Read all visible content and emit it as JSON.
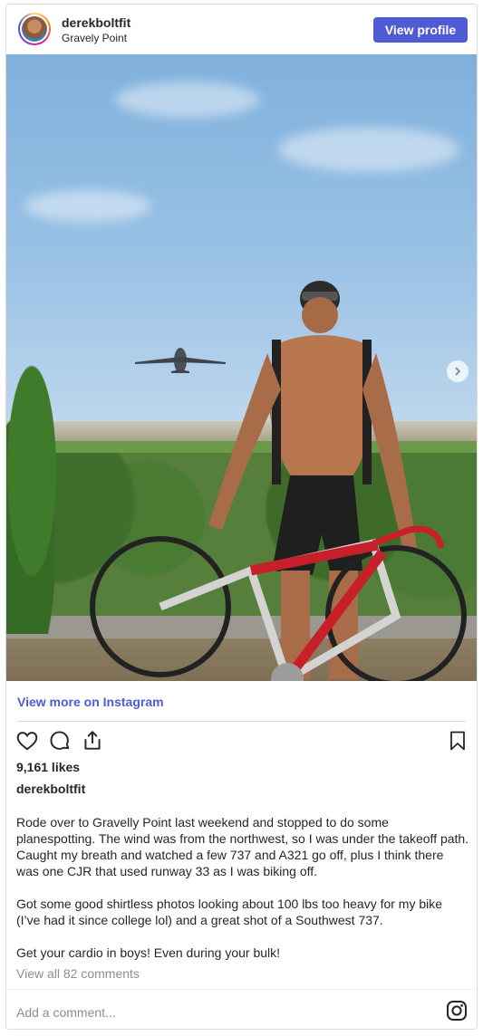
{
  "header": {
    "username": "derekboltfit",
    "location": "Gravely Point",
    "view_profile_label": "View profile"
  },
  "post": {
    "view_more_label": "View more on Instagram",
    "likes": "9,161 likes",
    "caption_username": "derekboltfit",
    "caption_paragraphs": [
      "Rode over to Gravelly Point last weekend and stopped to do some planespotting. The wind was from the northwest, so I was under the takeoff path. Caught my breath and watched a few 737 and A321 go off, plus I think there was one CJR that used runway 33 as I was biking off.",
      "Got some good shirtless photos looking about 100 lbs too heavy for my bike (I’ve had it since college lol) and a great shot of a Southwest 737.",
      "Get your cardio in boys! Even during your bulk!"
    ],
    "view_comments_label": "View all 82 comments",
    "add_comment_placeholder": "Add a comment..."
  },
  "icons": {
    "like": "heart-icon",
    "comment": "comment-icon",
    "share": "share-icon",
    "save": "bookmark-icon",
    "brand": "instagram-icon",
    "carousel_next": "chevron-right-icon"
  },
  "colors": {
    "accent": "#4f5bd5",
    "text": "#262626",
    "muted": "#8e8e8e",
    "border": "#dbdbdb"
  }
}
